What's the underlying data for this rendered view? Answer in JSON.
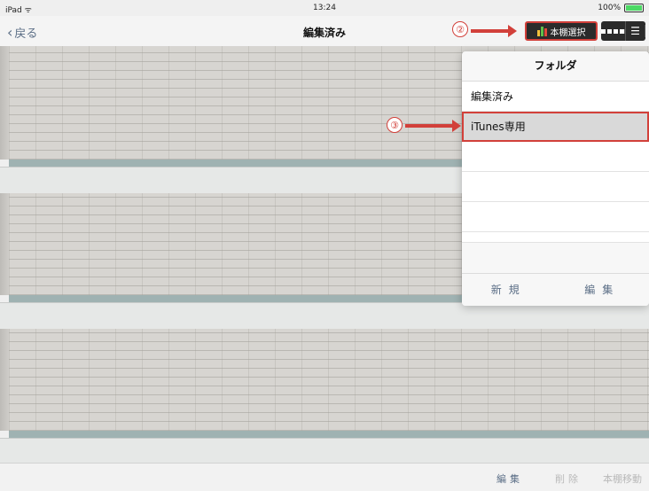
{
  "status": {
    "device": "iPad",
    "wifi_icon": "wifi-icon",
    "time": "13:24",
    "battery": "100%"
  },
  "nav": {
    "back_label": "戻る",
    "title": "編集済み",
    "shelf_button_label": "本棚選択"
  },
  "annotations": {
    "marker2": "②",
    "marker3": "③"
  },
  "popover": {
    "title": "フォルダ",
    "items": [
      "編集済み",
      "iTunes専用"
    ],
    "selected_index": 1,
    "footer": {
      "new_label": "新規",
      "edit_label": "編集"
    }
  },
  "toolbar": {
    "edit_label": "編集",
    "delete_label": "削除",
    "move_label": "本棚移動"
  },
  "colors": {
    "accent": "#d2403a",
    "link": "#5b6e86",
    "disabled": "#b9b9b9",
    "dark_button": "#2b2b2b"
  }
}
